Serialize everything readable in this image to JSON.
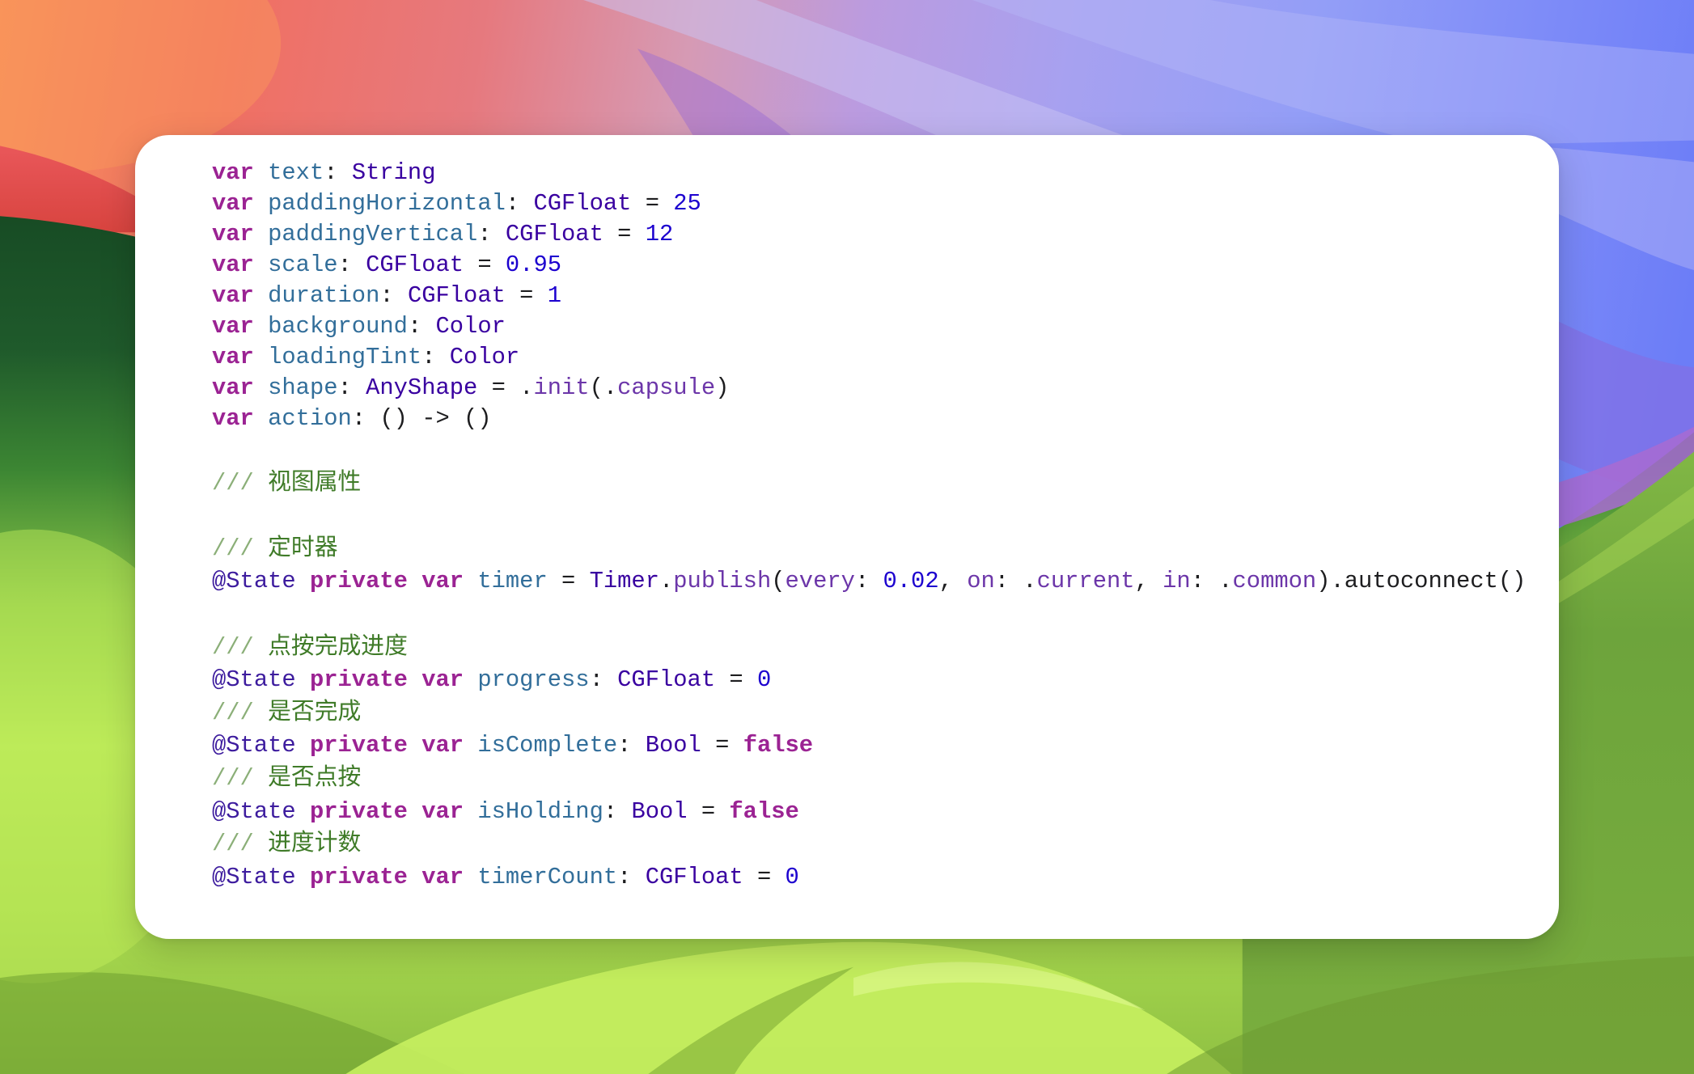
{
  "code": {
    "blocks": [
      {
        "lines": [
          {
            "tokens": [
              {
                "text": "var ",
                "color": "#9B2393",
                "bold": true
              },
              {
                "text": "text",
                "color": "#326E9A"
              },
              {
                "text": ": ",
                "color": "#1D1D1F"
              },
              {
                "text": "String",
                "color": "#3900A0"
              }
            ]
          },
          {
            "tokens": [
              {
                "text": "var ",
                "color": "#9B2393",
                "bold": true
              },
              {
                "text": "paddingHorizontal",
                "color": "#326E9A"
              },
              {
                "text": ": ",
                "color": "#1D1D1F"
              },
              {
                "text": "CGFloat",
                "color": "#3900A0"
              },
              {
                "text": " = ",
                "color": "#1D1D1F"
              },
              {
                "text": "25",
                "color": "#1C00CF"
              }
            ]
          },
          {
            "tokens": [
              {
                "text": "var ",
                "color": "#9B2393",
                "bold": true
              },
              {
                "text": "paddingVertical",
                "color": "#326E9A"
              },
              {
                "text": ": ",
                "color": "#1D1D1F"
              },
              {
                "text": "CGFloat",
                "color": "#3900A0"
              },
              {
                "text": " = ",
                "color": "#1D1D1F"
              },
              {
                "text": "12",
                "color": "#1C00CF"
              }
            ]
          },
          {
            "tokens": [
              {
                "text": "var ",
                "color": "#9B2393",
                "bold": true
              },
              {
                "text": "scale",
                "color": "#326E9A"
              },
              {
                "text": ": ",
                "color": "#1D1D1F"
              },
              {
                "text": "CGFloat",
                "color": "#3900A0"
              },
              {
                "text": " = ",
                "color": "#1D1D1F"
              },
              {
                "text": "0.95",
                "color": "#1C00CF"
              }
            ]
          },
          {
            "tokens": [
              {
                "text": "var ",
                "color": "#9B2393",
                "bold": true
              },
              {
                "text": "duration",
                "color": "#326E9A"
              },
              {
                "text": ": ",
                "color": "#1D1D1F"
              },
              {
                "text": "CGFloat",
                "color": "#3900A0"
              },
              {
                "text": " = ",
                "color": "#1D1D1F"
              },
              {
                "text": "1",
                "color": "#1C00CF"
              }
            ]
          },
          {
            "tokens": [
              {
                "text": "var ",
                "color": "#9B2393",
                "bold": true
              },
              {
                "text": "background",
                "color": "#326E9A"
              },
              {
                "text": ": ",
                "color": "#1D1D1F"
              },
              {
                "text": "Color",
                "color": "#3900A0"
              }
            ]
          },
          {
            "tokens": [
              {
                "text": "var ",
                "color": "#9B2393",
                "bold": true
              },
              {
                "text": "loadingTint",
                "color": "#326E9A"
              },
              {
                "text": ": ",
                "color": "#1D1D1F"
              },
              {
                "text": "Color",
                "color": "#3900A0"
              }
            ]
          },
          {
            "tokens": [
              {
                "text": "var ",
                "color": "#9B2393",
                "bold": true
              },
              {
                "text": "shape",
                "color": "#326E9A"
              },
              {
                "text": ": ",
                "color": "#1D1D1F"
              },
              {
                "text": "AnyShape",
                "color": "#3900A0"
              },
              {
                "text": " = .",
                "color": "#1D1D1F"
              },
              {
                "text": "init",
                "color": "#6C36A9"
              },
              {
                "text": "(.",
                "color": "#1D1D1F"
              },
              {
                "text": "capsule",
                "color": "#6C36A9"
              },
              {
                "text": ")",
                "color": "#1D1D1F"
              }
            ]
          },
          {
            "tokens": [
              {
                "text": "var ",
                "color": "#9B2393",
                "bold": true
              },
              {
                "text": "action",
                "color": "#326E9A"
              },
              {
                "text": ": () -> ()",
                "color": "#1D1D1F"
              }
            ]
          }
        ]
      },
      {
        "lines": [
          {
            "tokens": []
          },
          {
            "tokens": [
              {
                "text": "///",
                "color": "#8BAF78"
              },
              {
                "text": " 视图属性",
                "color": "#3F7B28"
              }
            ]
          },
          {
            "tokens": []
          },
          {
            "tokens": [
              {
                "text": "///",
                "color": "#8BAF78"
              },
              {
                "text": " 定时器",
                "color": "#3F7B28"
              }
            ]
          },
          {
            "tokens": [
              {
                "text": "@State ",
                "color": "#3D1C9E"
              },
              {
                "text": "private ",
                "color": "#9B2393",
                "bold": true
              },
              {
                "text": "var ",
                "color": "#9B2393",
                "bold": true
              },
              {
                "text": "timer",
                "color": "#326E9A"
              },
              {
                "text": " = ",
                "color": "#1D1D1F"
              },
              {
                "text": "Timer",
                "color": "#3900A0"
              },
              {
                "text": ".",
                "color": "#1D1D1F"
              },
              {
                "text": "publish",
                "color": "#6C36A9"
              },
              {
                "text": "(",
                "color": "#1D1D1F"
              },
              {
                "text": "every",
                "color": "#6C36A9"
              },
              {
                "text": ": ",
                "color": "#1D1D1F"
              },
              {
                "text": "0.02",
                "color": "#1C00CF"
              },
              {
                "text": ", ",
                "color": "#1D1D1F"
              },
              {
                "text": "on",
                "color": "#6C36A9"
              },
              {
                "text": ": .",
                "color": "#1D1D1F"
              },
              {
                "text": "current",
                "color": "#6C36A9"
              },
              {
                "text": ", ",
                "color": "#1D1D1F"
              },
              {
                "text": "in",
                "color": "#6C36A9"
              },
              {
                "text": ": .",
                "color": "#1D1D1F"
              },
              {
                "text": "common",
                "color": "#6C36A9"
              },
              {
                "text": ").autoconnect()",
                "color": "#1D1D1F"
              }
            ]
          },
          {
            "tokens": []
          },
          {
            "tokens": [
              {
                "text": "///",
                "color": "#8BAF78"
              },
              {
                "text": " 点按完成进度",
                "color": "#3F7B28"
              }
            ]
          },
          {
            "tokens": [
              {
                "text": "@State ",
                "color": "#3D1C9E"
              },
              {
                "text": "private ",
                "color": "#9B2393",
                "bold": true
              },
              {
                "text": "var ",
                "color": "#9B2393",
                "bold": true
              },
              {
                "text": "progress",
                "color": "#326E9A"
              },
              {
                "text": ": ",
                "color": "#1D1D1F"
              },
              {
                "text": "CGFloat",
                "color": "#3900A0"
              },
              {
                "text": " = ",
                "color": "#1D1D1F"
              },
              {
                "text": "0",
                "color": "#1C00CF"
              }
            ]
          },
          {
            "tokens": [
              {
                "text": "///",
                "color": "#8BAF78"
              },
              {
                "text": " 是否完成",
                "color": "#3F7B28"
              }
            ]
          },
          {
            "tokens": [
              {
                "text": "@State ",
                "color": "#3D1C9E"
              },
              {
                "text": "private ",
                "color": "#9B2393",
                "bold": true
              },
              {
                "text": "var ",
                "color": "#9B2393",
                "bold": true
              },
              {
                "text": "isComplete",
                "color": "#326E9A"
              },
              {
                "text": ": ",
                "color": "#1D1D1F"
              },
              {
                "text": "Bool",
                "color": "#3900A0"
              },
              {
                "text": " = ",
                "color": "#1D1D1F"
              },
              {
                "text": "false",
                "color": "#9B2393",
                "bold": true
              }
            ]
          },
          {
            "tokens": [
              {
                "text": "///",
                "color": "#8BAF78"
              },
              {
                "text": " 是否点按",
                "color": "#3F7B28"
              }
            ]
          },
          {
            "tokens": [
              {
                "text": "@State ",
                "color": "#3D1C9E"
              },
              {
                "text": "private ",
                "color": "#9B2393",
                "bold": true
              },
              {
                "text": "var ",
                "color": "#9B2393",
                "bold": true
              },
              {
                "text": "isHolding",
                "color": "#326E9A"
              },
              {
                "text": ": ",
                "color": "#1D1D1F"
              },
              {
                "text": "Bool",
                "color": "#3900A0"
              },
              {
                "text": " = ",
                "color": "#1D1D1F"
              },
              {
                "text": "false",
                "color": "#9B2393",
                "bold": true
              }
            ]
          },
          {
            "tokens": [
              {
                "text": "///",
                "color": "#8BAF78"
              },
              {
                "text": " 进度计数",
                "color": "#3F7B28"
              }
            ]
          },
          {
            "tokens": [
              {
                "text": "@State ",
                "color": "#3D1C9E"
              },
              {
                "text": "private ",
                "color": "#9B2393",
                "bold": true
              },
              {
                "text": "var ",
                "color": "#9B2393",
                "bold": true
              },
              {
                "text": "timerCount",
                "color": "#326E9A"
              },
              {
                "text": ": ",
                "color": "#1D1D1F"
              },
              {
                "text": "CGFloat",
                "color": "#3900A0"
              },
              {
                "text": " = ",
                "color": "#1D1D1F"
              },
              {
                "text": "0",
                "color": "#1C00CF"
              }
            ]
          }
        ]
      }
    ]
  }
}
